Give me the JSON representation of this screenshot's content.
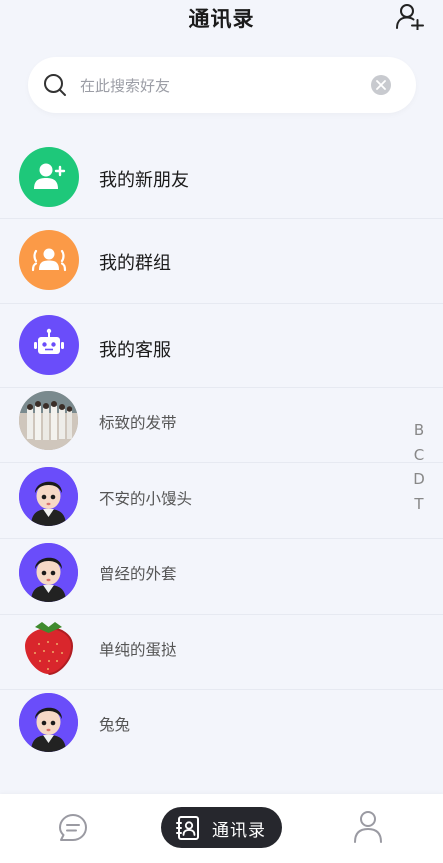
{
  "header": {
    "title": "通讯录"
  },
  "search": {
    "placeholder": "在此搜索好友"
  },
  "menu": [
    {
      "label": "我的新朋友",
      "icon": "add-user-icon",
      "color": "#1ec87a"
    },
    {
      "label": "我的群组",
      "icon": "group-icon",
      "color": "#fb9a47"
    },
    {
      "label": "我的客服",
      "icon": "robot-icon",
      "color": "#6a4dfa"
    }
  ],
  "contacts": [
    {
      "name": "标致的发带",
      "avatar": "group-photo"
    },
    {
      "name": "不安的小馒头",
      "avatar": "cartoon-boy"
    },
    {
      "name": "曾经的外套",
      "avatar": "cartoon-boy"
    },
    {
      "name": "单纯的蛋挞",
      "avatar": "strawberry"
    },
    {
      "name": "兔兔",
      "avatar": "cartoon-boy"
    }
  ],
  "index_letters": [
    "B",
    "C",
    "D",
    "T"
  ],
  "tabbar": {
    "tabs": [
      {
        "icon": "chat-icon"
      },
      {
        "label": "通讯录",
        "icon": "contacts-icon",
        "active": true
      },
      {
        "icon": "profile-icon"
      }
    ]
  }
}
